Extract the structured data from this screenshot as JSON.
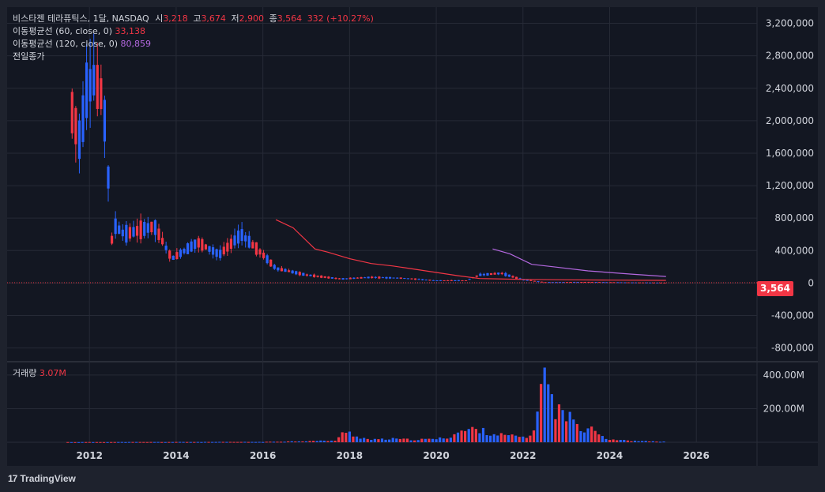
{
  "legend": {
    "symbol_line": "비스타젠 테라퓨틱스, 1달, NASDAQ",
    "o_label": "시",
    "o_value": "3,218",
    "h_label": "고",
    "h_value": "3,674",
    "l_label": "저",
    "l_value": "2,900",
    "c_label": "종",
    "c_value": "3,564",
    "change": "332 (+10.27%)",
    "ma60_label": "이동평균선 (60, close, 0)",
    "ma60_value": "33,138",
    "ma120_label": "이동평균선 (120, close, 0)",
    "ma120_value": "80,859",
    "prev_close_label": "전일종가",
    "volume_label": "거래량",
    "volume_value": "3.07M"
  },
  "price_badge": "3,564",
  "footer": {
    "logo_icon": "tradingview-logo-icon",
    "brand": "TradingView"
  },
  "colors": {
    "up": "#f23645",
    "down": "#2962ff",
    "ma60": "#f23645",
    "ma120": "#b468e0",
    "grid": "#262a36",
    "background": "#131722"
  },
  "chart_data": [
    {
      "type": "candlestick",
      "title": "비스타젠 테라퓨틱스, 1달, NASDAQ",
      "x_ticks": [
        "2012",
        "2014",
        "2016",
        "2018",
        "2020",
        "2022",
        "2024",
        "2026"
      ],
      "y_ticks": [
        "3,200,000",
        "2,800,000",
        "2,400,000",
        "2,000,000",
        "1,600,000",
        "1,200,000",
        "800,000",
        "400,000",
        "0",
        "-400,000",
        "-800,000"
      ],
      "y_tick_values": [
        3200000,
        2800000,
        2400000,
        2000000,
        1600000,
        1200000,
        800000,
        400000,
        0,
        -400000,
        -800000
      ],
      "ylim": [
        -950000,
        3400000
      ],
      "xlim": [
        2010.1,
        2027.4
      ],
      "last_price": 3564,
      "anchors_ohlc_year": [
        [
          2011.6,
          2000000,
          2150000,
          1700000,
          2100000
        ],
        [
          2011.8,
          1800000,
          2000000,
          1500000,
          1700000
        ],
        [
          2011.9,
          2100000,
          2400000,
          2000000,
          2350000
        ],
        [
          2012.1,
          2400000,
          2600000,
          2200000,
          2500000
        ],
        [
          2012.3,
          2500000,
          2550000,
          2100000,
          2300000
        ],
        [
          2012.4,
          2300000,
          2400000,
          1600000,
          1700000
        ],
        [
          2012.5,
          900000,
          1300000,
          400000,
          500000
        ],
        [
          2012.6,
          600000,
          1250000,
          60000,
          700000
        ],
        [
          2012.8,
          800000,
          900000,
          500000,
          600000
        ],
        [
          2013.5,
          600000,
          750000,
          400000,
          700000
        ],
        [
          2013.9,
          450000,
          600000,
          250000,
          300000
        ],
        [
          2014.5,
          400000,
          600000,
          250000,
          500000
        ],
        [
          2015.0,
          500000,
          600000,
          300000,
          350000
        ],
        [
          2015.5,
          500000,
          700000,
          350000,
          600000
        ],
        [
          2016.0,
          300000,
          400000,
          250000,
          350000
        ],
        [
          2016.3,
          150000,
          350000,
          120000,
          180000
        ],
        [
          2017.0,
          120000,
          180000,
          80000,
          100000
        ],
        [
          2017.8,
          60000,
          100000,
          30000,
          50000
        ],
        [
          2018.5,
          40000,
          90000,
          20000,
          70000
        ],
        [
          2019.2,
          70000,
          110000,
          40000,
          60000
        ],
        [
          2020.0,
          20000,
          50000,
          5000,
          30000
        ],
        [
          2020.7,
          20000,
          40000,
          5000,
          30000
        ],
        [
          2021.0,
          80000,
          120000,
          40000,
          100000
        ],
        [
          2021.5,
          130000,
          170000,
          90000,
          120000
        ],
        [
          2022.0,
          60000,
          90000,
          30000,
          40000
        ],
        [
          2022.5,
          20000,
          40000,
          5000,
          10000
        ],
        [
          2023.5,
          10000,
          30000,
          4000,
          12000
        ],
        [
          2024.5,
          6000,
          15000,
          3000,
          7000
        ],
        [
          2025.3,
          3218,
          3674,
          2900,
          3564
        ]
      ],
      "ma60_points": [
        [
          2016.3,
          780000
        ],
        [
          2016.7,
          680000
        ],
        [
          2017.2,
          420000
        ],
        [
          2017.5,
          380000
        ],
        [
          2018.0,
          300000
        ],
        [
          2018.5,
          240000
        ],
        [
          2019.0,
          210000
        ],
        [
          2019.5,
          170000
        ],
        [
          2020.0,
          130000
        ],
        [
          2020.5,
          90000
        ],
        [
          2021.0,
          55000
        ],
        [
          2022.0,
          45000
        ],
        [
          2023.0,
          40000
        ],
        [
          2024.0,
          36000
        ],
        [
          2025.3,
          33138
        ]
      ],
      "ma120_points": [
        [
          2021.3,
          420000
        ],
        [
          2021.7,
          360000
        ],
        [
          2022.2,
          230000
        ],
        [
          2022.7,
          200000
        ],
        [
          2023.5,
          150000
        ],
        [
          2024.5,
          110000
        ],
        [
          2025.3,
          80859
        ]
      ]
    },
    {
      "type": "bar",
      "title": "거래량",
      "y_ticks": [
        "400.00M",
        "200.00M"
      ],
      "y_tick_values": [
        400000000,
        200000000
      ],
      "ylim": [
        0,
        470000000
      ],
      "volume_anchors": [
        [
          2011.5,
          1000000
        ],
        [
          2016.0,
          2000000
        ],
        [
          2017.7,
          10000000
        ],
        [
          2017.9,
          70000000
        ],
        [
          2018.2,
          30000000
        ],
        [
          2018.5,
          15000000
        ],
        [
          2019.0,
          20000000
        ],
        [
          2019.5,
          15000000
        ],
        [
          2020.0,
          20000000
        ],
        [
          2020.3,
          30000000
        ],
        [
          2020.5,
          60000000
        ],
        [
          2020.9,
          80000000
        ],
        [
          2021.3,
          50000000
        ],
        [
          2021.8,
          35000000
        ],
        [
          2022.2,
          30000000
        ],
        [
          2022.45,
          360000000
        ],
        [
          2022.55,
          410000000
        ],
        [
          2022.7,
          200000000
        ],
        [
          2022.9,
          180000000
        ],
        [
          2023.1,
          140000000
        ],
        [
          2023.4,
          80000000
        ],
        [
          2023.6,
          100000000
        ],
        [
          2023.9,
          20000000
        ],
        [
          2024.5,
          8000000
        ],
        [
          2025.3,
          3070000
        ]
      ]
    }
  ]
}
